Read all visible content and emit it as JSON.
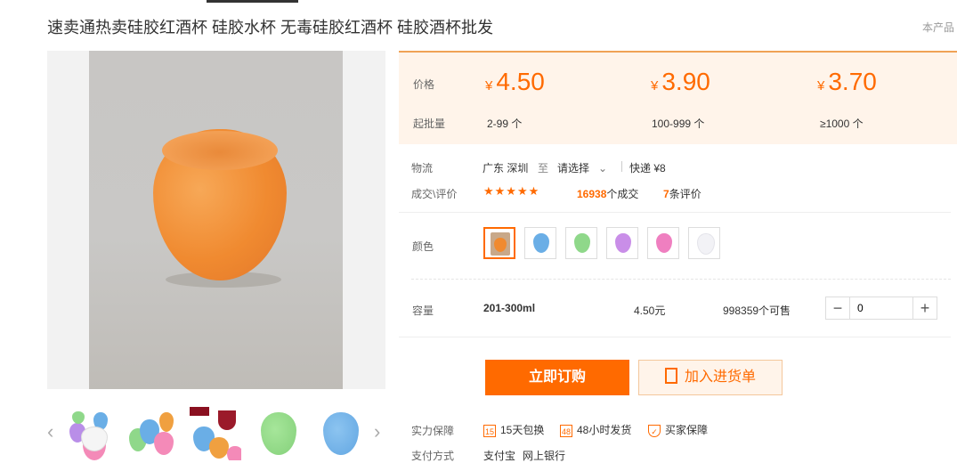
{
  "title": "速卖通热卖硅胶红酒杯 硅胶水杯 无毒硅胶红酒杯 硅胶酒杯批发",
  "product_note": "本产品",
  "pricing": {
    "price_label": "价格",
    "moq_label": "起批量",
    "currency": "¥",
    "tiers": [
      {
        "price": "4.50",
        "qty": "2-99 个"
      },
      {
        "price": "3.90",
        "qty": "100-999 个"
      },
      {
        "price": "3.70",
        "qty": "≥1000 个"
      }
    ]
  },
  "logistics": {
    "label": "物流",
    "origin": "广东 深圳",
    "to": "至",
    "destination": "请选择",
    "shipping": "快递 ¥8"
  },
  "transactions": {
    "label": "成交\\评价",
    "stars": "★★★★★",
    "deals_count": "16938",
    "deals_suffix": "个成交",
    "reviews_count": "7",
    "reviews_suffix": "条评价"
  },
  "color": {
    "label": "颜色",
    "swatch_colors": [
      "#f08a30",
      "#6aaee6",
      "#8fd88a",
      "#c98ee8",
      "#ef7fc0",
      "#f2f2f6"
    ]
  },
  "capacity": {
    "label": "容量",
    "value": "201-300ml",
    "price": "4.50元",
    "stock": "998359个可售",
    "quantity": "0",
    "minus": "−",
    "plus": "+"
  },
  "actions": {
    "buy_now": "立即订购",
    "add_to_list": "加入进货单"
  },
  "guarantee": {
    "label": "实力保障",
    "items": [
      "15天包换",
      "48小时发货",
      "买家保障"
    ]
  },
  "payment": {
    "label": "支付方式",
    "methods": [
      "支付宝",
      "网上银行"
    ]
  },
  "thumbnails": {
    "prev": "‹",
    "next": "›"
  }
}
